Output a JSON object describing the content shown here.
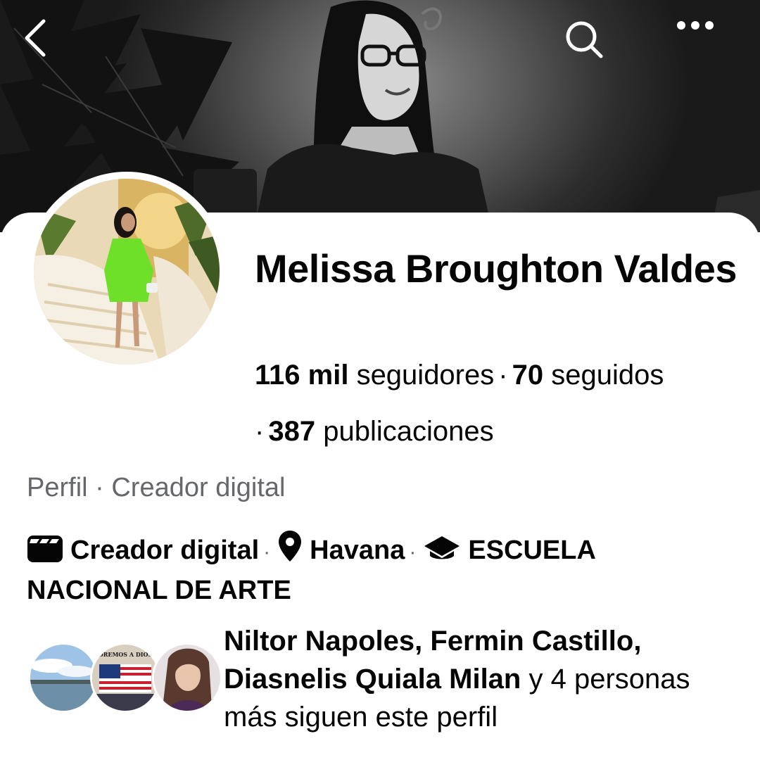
{
  "header": {
    "back_icon": "chevron-left-icon",
    "search_icon": "search-icon",
    "more_icon": "more-horizontal-icon"
  },
  "profile": {
    "name": "Melissa Broughton Valdes",
    "followers_count": "116 mil",
    "followers_label": "seguidores",
    "following_count": "70",
    "following_label": "seguidos",
    "posts_count": "387",
    "posts_label": "publicaciones",
    "separator": "·",
    "subtitle": "Perfil · Creador digital"
  },
  "details": {
    "category": "Creador digital",
    "location": "Havana",
    "education": "ESCUELA NACIONAL DE ARTE",
    "separator": "·"
  },
  "mutual": {
    "names": "Niltor Napoles, Fermin Castillo, Diasnelis Quiala Milan",
    "rest": " y 4 personas más siguen este perfil",
    "avatar_caption": "OREMOS A DIOS"
  },
  "colors": {
    "text_primary": "#050505",
    "text_secondary": "#65676b",
    "background": "#ffffff",
    "avatar_dress": "#6fe02a"
  }
}
